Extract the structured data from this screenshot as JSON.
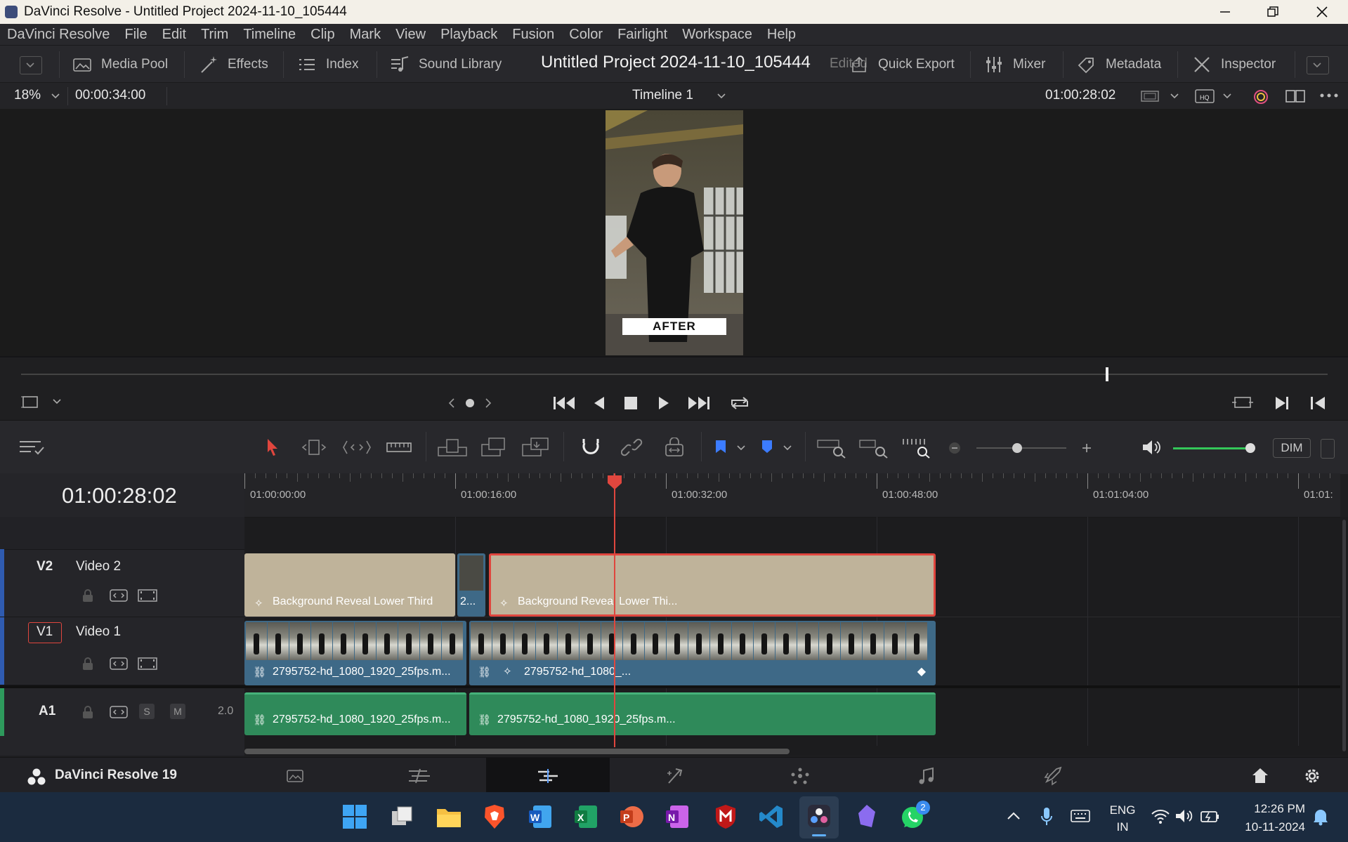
{
  "window": {
    "title": "DaVinci Resolve - Untitled Project 2024-11-10_105444"
  },
  "menu": [
    "DaVinci Resolve",
    "File",
    "Edit",
    "Trim",
    "Timeline",
    "Clip",
    "Mark",
    "View",
    "Playback",
    "Fusion",
    "Color",
    "Fairlight",
    "Workspace",
    "Help"
  ],
  "toolbar": {
    "media_pool": "Media Pool",
    "effects": "Effects",
    "index": "Index",
    "sound_library": "Sound Library",
    "project_title": "Untitled Project 2024-11-10_105444",
    "edited": "Edited",
    "quick_export": "Quick Export",
    "mixer": "Mixer",
    "metadata": "Metadata",
    "inspector": "Inspector"
  },
  "viewer": {
    "zoom": "18%",
    "duration": "00:00:34:00",
    "timeline_name": "Timeline 1",
    "timecode": "01:00:28:02",
    "overlay_text": "AFTER",
    "scrubber_position": 0.83
  },
  "timeline_toolbar": {
    "dim_label": "DIM",
    "zoom_level": 0.45,
    "volume_level": 0.95
  },
  "timeline": {
    "current_timecode": "01:00:28:02",
    "ruler": [
      "01:00:00:00",
      "01:00:16:00",
      "01:00:32:00",
      "01:00:48:00",
      "01:01:04:00",
      "01:01:"
    ],
    "tracks": [
      {
        "code": "V2",
        "name": "Video 2"
      },
      {
        "code": "V1",
        "name": "Video 1"
      },
      {
        "code": "A1",
        "name": "",
        "solo": "S",
        "mute": "M",
        "channels": "2.0"
      }
    ],
    "v2_clips": [
      "Background Reveal Lower Third",
      "2...",
      "Background Reveal Lower Thi..."
    ],
    "v1_clips": [
      "2795752-hd_1080_1920_25fps.m...",
      "2795752-hd_1080_..."
    ],
    "a1_clips": [
      "2795752-hd_1080_1920_25fps.m...",
      "2795752-hd_1080_1920_25fps.m..."
    ]
  },
  "pagebar": {
    "brand": "DaVinci Resolve 19"
  },
  "taskbar": {
    "lang_top": "ENG",
    "lang_bottom": "IN",
    "time": "12:26 PM",
    "date": "10-11-2024",
    "whatsapp_badge": "2"
  },
  "colors": {
    "accent_red": "#e0463e",
    "title_clip": "#bfb39a",
    "audio_clip": "#2f8a5a",
    "taskbar": "#1b2b3f"
  }
}
